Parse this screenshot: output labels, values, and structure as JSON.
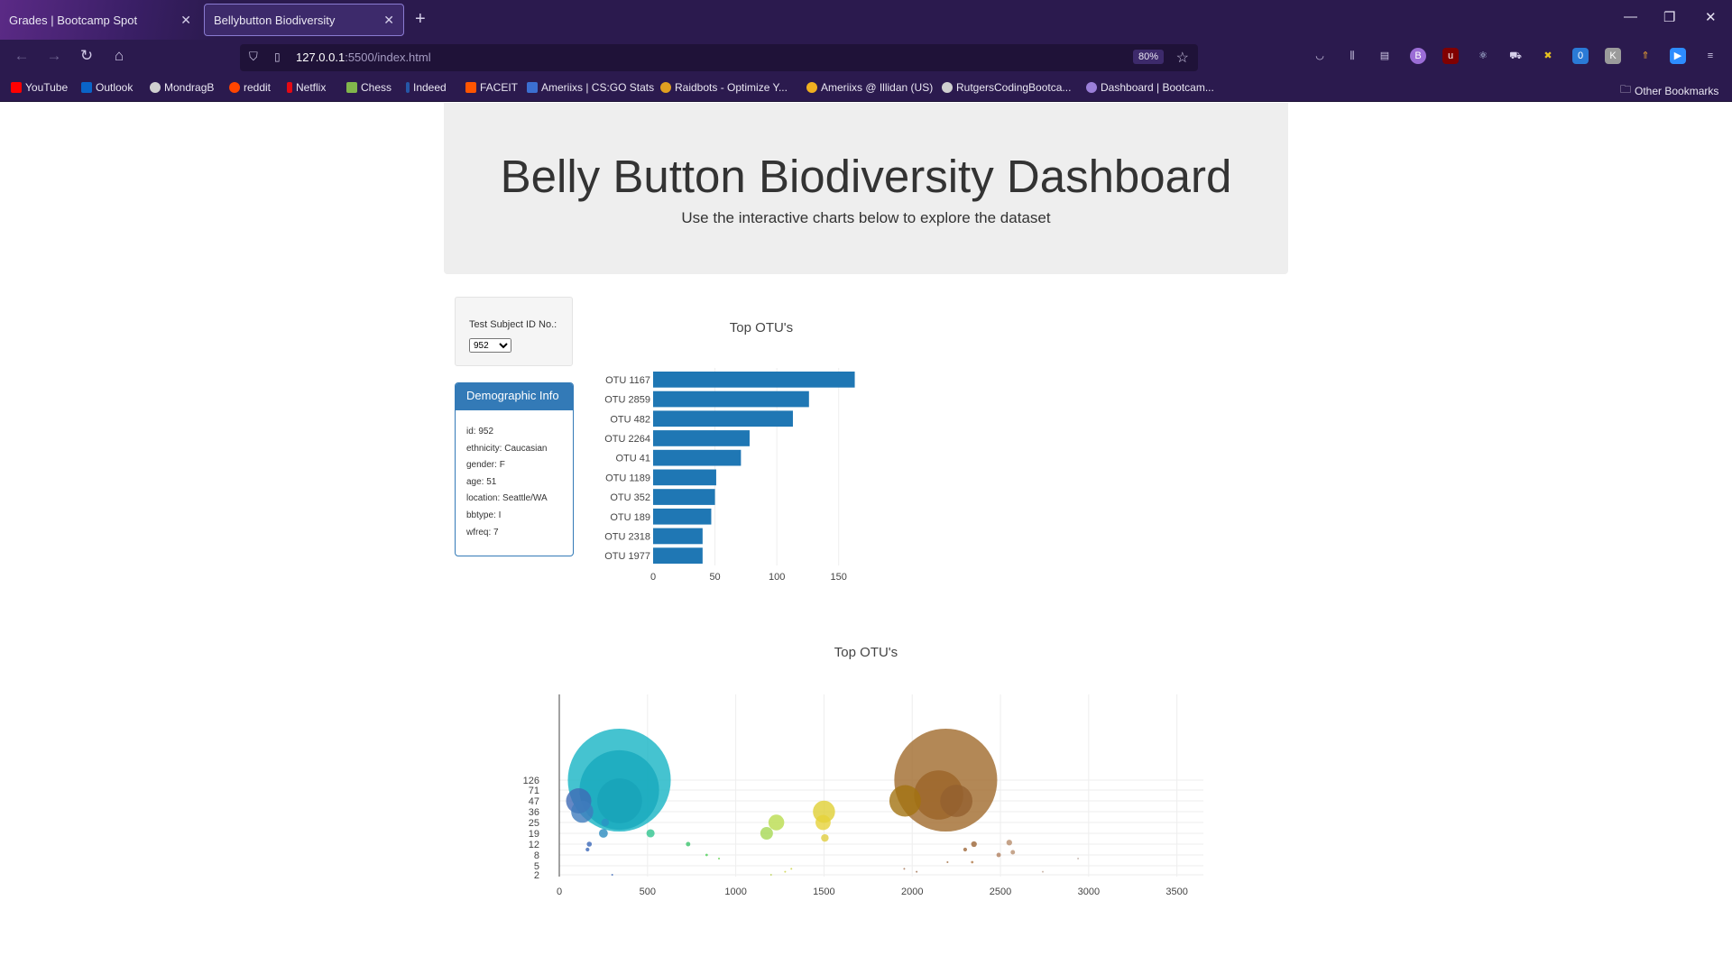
{
  "browser": {
    "tabs": [
      {
        "label": "Grades | Bootcamp Spot",
        "active": false
      },
      {
        "label": "Bellybutton Biodiversity",
        "active": true
      }
    ],
    "url_host": "127.0.0.1",
    "url_path": ":5500/index.html",
    "zoom": "80%",
    "bookmarks": [
      {
        "label": "YouTube",
        "color": "#ff0000"
      },
      {
        "label": "Outlook",
        "color": "#0a64c8"
      },
      {
        "label": "MondragB",
        "color": "#d0d0d0"
      },
      {
        "label": "reddit",
        "color": "#ff4500"
      },
      {
        "label": "Netflix",
        "color": "#e50914"
      },
      {
        "label": "Chess",
        "color": "#81b64c"
      },
      {
        "label": "Indeed",
        "color": "#2557a7"
      },
      {
        "label": "FACEIT",
        "color": "#ff5500"
      },
      {
        "label": "Ameriixs | CS:GO Stats",
        "color": "#3b6fd1"
      },
      {
        "label": "Raidbots - Optimize Y...",
        "color": "#e0a020"
      },
      {
        "label": "Ameriixs @ Illidan (US)",
        "color": "#f0b020"
      },
      {
        "label": "RutgersCodingBootca...",
        "color": "#d0d0d0"
      },
      {
        "label": "Dashboard | Bootcam...",
        "color": "#9b7fd8"
      }
    ],
    "other_bookmarks": "Other Bookmarks"
  },
  "header": {
    "title": "Belly Button Biodiversity Dashboard",
    "subtitle": "Use the interactive charts below to explore the dataset"
  },
  "selector": {
    "label": "Test Subject ID No.:",
    "selected": "952"
  },
  "demographic": {
    "heading": "Demographic Info",
    "rows": [
      "id: 952",
      "ethnicity: Caucasian",
      "gender: F",
      "age: 51",
      "location: Seattle/WA",
      "bbtype: I",
      "wfreq: 7"
    ]
  },
  "chart_data": [
    {
      "type": "bar",
      "orientation": "horizontal",
      "title": "Top OTU's",
      "categories": [
        "OTU 1167",
        "OTU 2859",
        "OTU 482",
        "OTU 2264",
        "OTU 41",
        "OTU 1189",
        "OTU 352",
        "OTU 189",
        "OTU 2318",
        "OTU 1977"
      ],
      "values": [
        163,
        126,
        113,
        78,
        71,
        51,
        50,
        47,
        40,
        40
      ],
      "xlim": [
        0,
        175
      ],
      "xticks": [
        0,
        50,
        100,
        150
      ],
      "bar_color": "#1f77b4"
    },
    {
      "type": "scatter",
      "title": "Top OTU's",
      "xlim": [
        0,
        3650
      ],
      "xticks": [
        0,
        500,
        1000,
        1500,
        2000,
        2500,
        3000,
        3500
      ],
      "yticks": [
        2,
        5,
        8,
        12,
        19,
        25,
        36,
        47,
        71,
        126
      ],
      "bubbles": [
        {
          "x": 340,
          "y": 126,
          "size": 163,
          "color": "#17b4c4"
        },
        {
          "x": 340,
          "y": 71,
          "size": 126,
          "color": "#17a9bd"
        },
        {
          "x": 342,
          "y": 47,
          "size": 71,
          "color": "#18a3b8"
        },
        {
          "x": 110,
          "y": 47,
          "size": 40,
          "color": "#3f6ab5"
        },
        {
          "x": 130,
          "y": 36,
          "size": 35,
          "color": "#3e7cbd"
        },
        {
          "x": 250,
          "y": 19,
          "size": 14,
          "color": "#2a8bbf"
        },
        {
          "x": 260,
          "y": 25,
          "size": 12,
          "color": "#2c92c4"
        },
        {
          "x": 170,
          "y": 12,
          "size": 8,
          "color": "#3a66b8"
        },
        {
          "x": 160,
          "y": 10,
          "size": 6,
          "color": "#3a66b8"
        },
        {
          "x": 517,
          "y": 19,
          "size": 13,
          "color": "#2fc48e"
        },
        {
          "x": 730,
          "y": 12,
          "size": 7,
          "color": "#3bc46d"
        },
        {
          "x": 835,
          "y": 8,
          "size": 4,
          "color": "#4ccf57"
        },
        {
          "x": 905,
          "y": 7,
          "size": 3,
          "color": "#5bd24a"
        },
        {
          "x": 1175,
          "y": 19,
          "size": 20,
          "color": "#a6d854"
        },
        {
          "x": 1230,
          "y": 25,
          "size": 25,
          "color": "#b9dc4e"
        },
        {
          "x": 1500,
          "y": 36,
          "size": 35,
          "color": "#e0cf35"
        },
        {
          "x": 1495,
          "y": 25,
          "size": 24,
          "color": "#e6d23a"
        },
        {
          "x": 1505,
          "y": 16,
          "size": 12,
          "color": "#e0cd40"
        },
        {
          "x": 1960,
          "y": 47,
          "size": 50,
          "color": "#a27312"
        },
        {
          "x": 2190,
          "y": 126,
          "size": 163,
          "color": "#a06a2c"
        },
        {
          "x": 2150,
          "y": 60,
          "size": 78,
          "color": "#9b6428"
        },
        {
          "x": 2250,
          "y": 47,
          "size": 51,
          "color": "#936030"
        },
        {
          "x": 2350,
          "y": 12,
          "size": 9,
          "color": "#9b6434"
        },
        {
          "x": 2300,
          "y": 10,
          "size": 6,
          "color": "#a06a3c"
        },
        {
          "x": 2340,
          "y": 6,
          "size": 4,
          "color": "#b07a48"
        },
        {
          "x": 2490,
          "y": 8,
          "size": 7,
          "color": "#b08060"
        },
        {
          "x": 2550,
          "y": 13,
          "size": 9,
          "color": "#b88c6c"
        },
        {
          "x": 2570,
          "y": 9,
          "size": 7,
          "color": "#b89070"
        },
        {
          "x": 2200,
          "y": 6,
          "size": 3,
          "color": "#a06a3c"
        },
        {
          "x": 2940,
          "y": 7,
          "size": 3,
          "color": "#c0b0a8"
        },
        {
          "x": 1955,
          "y": 4,
          "size": 2,
          "color": "#a07050"
        },
        {
          "x": 2025,
          "y": 3,
          "size": 2,
          "color": "#a07050"
        },
        {
          "x": 2740,
          "y": 3,
          "size": 2,
          "color": "#c0a898"
        },
        {
          "x": 1315,
          "y": 4,
          "size": 2,
          "color": "#c8d040"
        },
        {
          "x": 1280,
          "y": 3,
          "size": 2,
          "color": "#c8d040"
        },
        {
          "x": 1200,
          "y": 2,
          "size": 2,
          "color": "#b8d050"
        },
        {
          "x": 300,
          "y": 2,
          "size": 2,
          "color": "#3a66b8"
        }
      ]
    }
  ]
}
